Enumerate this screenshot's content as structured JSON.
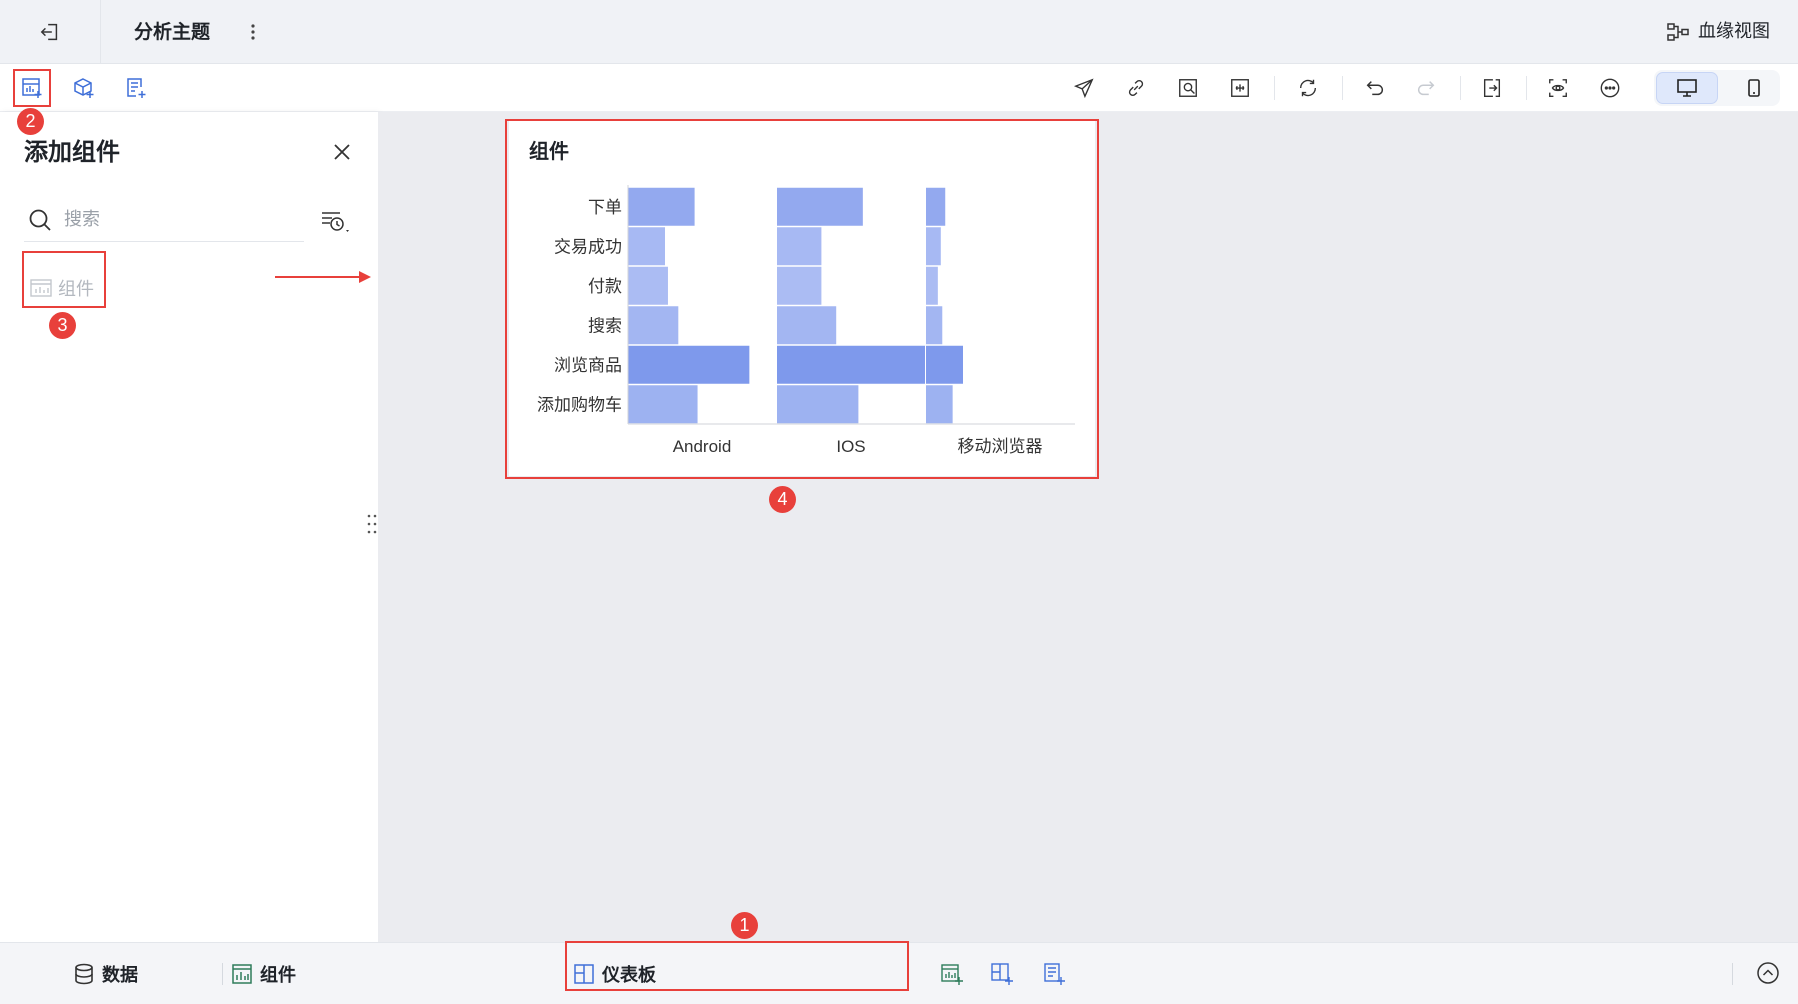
{
  "header": {
    "title": "分析主题",
    "lineage_label": "血缘视图"
  },
  "icons": {
    "back": "exit-icon",
    "more": "more-vertical-icon",
    "lineage": "lineage-icon"
  },
  "toolbar_right": [
    "send-icon",
    "link-icon",
    "image-search-icon",
    "fit-screen-icon",
    "refresh-icon",
    "undo-icon",
    "redo-icon",
    "layout-icon",
    "preview-icon",
    "more-icon"
  ],
  "panel": {
    "title": "添加组件",
    "search_placeholder": "搜索",
    "items": [
      {
        "label": "组件"
      }
    ]
  },
  "card": {
    "title": "组件"
  },
  "chart_data": {
    "type": "bar",
    "orientation": "horizontal",
    "layout": "small-multiples",
    "categories": [
      "下单",
      "交易成功",
      "付款",
      "搜索",
      "浏览商品",
      "添加购物车"
    ],
    "panels": [
      {
        "name": "Android",
        "values": [
          45,
          25,
          27,
          34,
          82,
          47
        ]
      },
      {
        "name": "IOS",
        "values": [
          58,
          30,
          30,
          40,
          100,
          55
        ]
      },
      {
        "name": "移动浏览器",
        "values": [
          13,
          10,
          8,
          11,
          25,
          18
        ]
      }
    ],
    "colors": [
      "#93a9ef",
      "#a7b9f3",
      "#abbcf3",
      "#a3b6f2",
      "#7e99ec",
      "#9db2f1"
    ],
    "grid": false
  },
  "markers": [
    "1",
    "2",
    "3",
    "4"
  ],
  "bottom": {
    "data_label": "数据",
    "components_label": "组件",
    "dashboard_label": "仪表板"
  }
}
